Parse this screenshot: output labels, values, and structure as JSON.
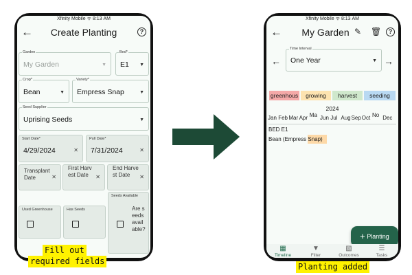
{
  "left_screen": {
    "status_carrier": "Xfinity Mobile",
    "status_time": "8:13 AM",
    "title": "Create Planting",
    "fields": {
      "garden": {
        "label": "Garden",
        "value": "My Garden"
      },
      "bed": {
        "label": "Bed*",
        "value": "E1"
      },
      "crop": {
        "label": "Crop*",
        "value": "Bean"
      },
      "variety": {
        "label": "Variety*",
        "value": "Empress Snap"
      },
      "seed_supplier": {
        "label": "Seed Supplier",
        "value": "Uprising Seeds"
      },
      "start_date": {
        "label": "Start Date*",
        "value": "4/29/2024"
      },
      "pull_date": {
        "label": "Pull Date*",
        "value": "7/31/2024"
      },
      "transplant_date": {
        "label": "Transplant Date"
      },
      "first_harvest_date": {
        "label": "First Harvest Date"
      },
      "end_harvest_date": {
        "label": "End Harvest Date"
      },
      "used_greenhouse": {
        "label": "Used Greenhouse"
      },
      "has_seeds": {
        "label": "Has Seeds"
      },
      "seeds_available": {
        "label": "Seeds Available",
        "question": "Are seeds available?"
      }
    }
  },
  "right_screen": {
    "status_carrier": "Xfinity Mobile",
    "status_time": "8:13 AM",
    "title": "My Garden",
    "time_interval": {
      "label": "Time Interval",
      "value": "One Year"
    },
    "legend": [
      {
        "label": "greenhous",
        "color": "#f4a9a8"
      },
      {
        "label": "growing",
        "color": "#fde3b0"
      },
      {
        "label": "harvest",
        "color": "#cfe8cc"
      },
      {
        "label": "seeding",
        "color": "#b9d9f2"
      }
    ],
    "year": "2024",
    "months": [
      "Jan",
      "Feb",
      "Mar",
      "Apr",
      "Ma",
      "Jun",
      "Jul",
      "Aug",
      "Sep",
      "Oct",
      "No",
      "Dec"
    ],
    "bed_label": "BED E1",
    "planting_label_a": "Bean (Empress ",
    "planting_label_b": "Snap)",
    "fab_label": "Planting",
    "nav": [
      "Timeline",
      "Filter",
      "Outcomes",
      "Tasks"
    ]
  },
  "captions": {
    "left_line1": "Fill out",
    "left_line2": "required fields",
    "right": "Planting added"
  },
  "colors": {
    "primary": "#24634a",
    "growing_bar": "#fdd9a8",
    "caption_bg": "#fff200"
  }
}
